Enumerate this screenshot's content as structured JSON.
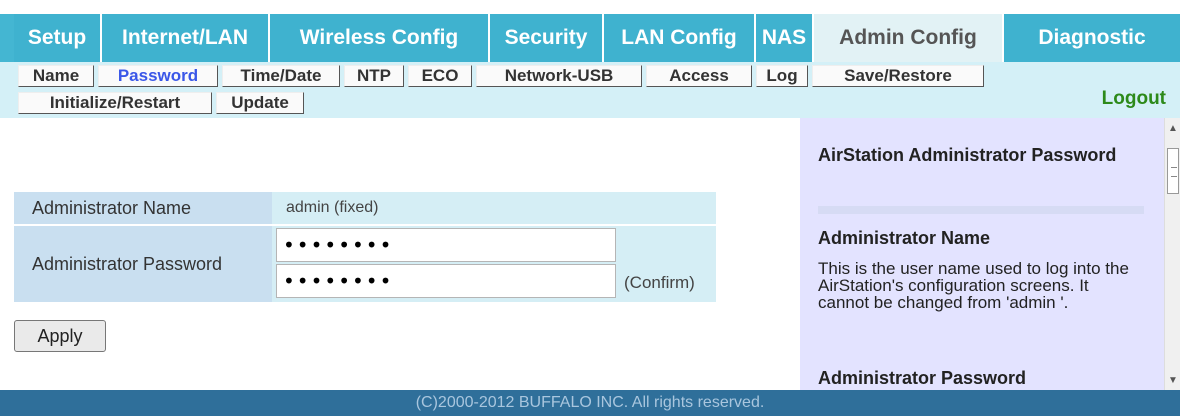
{
  "topnav": {
    "tabs": [
      {
        "label": "Setup"
      },
      {
        "label": "Internet/LAN"
      },
      {
        "label": "Wireless Config"
      },
      {
        "label": "Security"
      },
      {
        "label": "LAN Config"
      },
      {
        "label": "NAS"
      },
      {
        "label": "Admin Config",
        "active": true
      },
      {
        "label": "Diagnostic"
      }
    ]
  },
  "subnav": {
    "items": [
      {
        "label": "Name"
      },
      {
        "label": "Password",
        "active": true
      },
      {
        "label": "Time/Date"
      },
      {
        "label": "NTP"
      },
      {
        "label": "ECO"
      },
      {
        "label": "Network-USB"
      },
      {
        "label": "Access"
      },
      {
        "label": "Log"
      },
      {
        "label": "Save/Restore"
      },
      {
        "label": "Initialize/Restart"
      },
      {
        "label": "Update"
      }
    ],
    "logout_label": "Logout"
  },
  "form": {
    "admin_name_label": "Administrator Name",
    "admin_name_value": "admin (fixed)",
    "admin_password_label": "Administrator Password",
    "password_value": "••••••••",
    "confirm_value": "••••••••",
    "confirm_note": "(Confirm)",
    "apply_label": "Apply"
  },
  "help": {
    "title": "AirStation Administrator Password",
    "section1_heading": "Administrator Name",
    "section1_text": "This is the user name used to log into the AirStation's configuration screens. It cannot be changed from 'admin '.",
    "section2_heading": "Administrator Password"
  },
  "footer": {
    "copyright": "(C)2000-2012 BUFFALO INC. All rights reserved."
  },
  "colors": {
    "nav_bg": "#44b6d2",
    "active_tab_bg": "#e2f2f5",
    "subnav_bg": "#d4f0f7",
    "subnav_active_text": "#3a57e8",
    "logout_text": "#2d8a1a",
    "help_bg": "#e3e3ff",
    "footer_bg": "#2f6f9a"
  }
}
